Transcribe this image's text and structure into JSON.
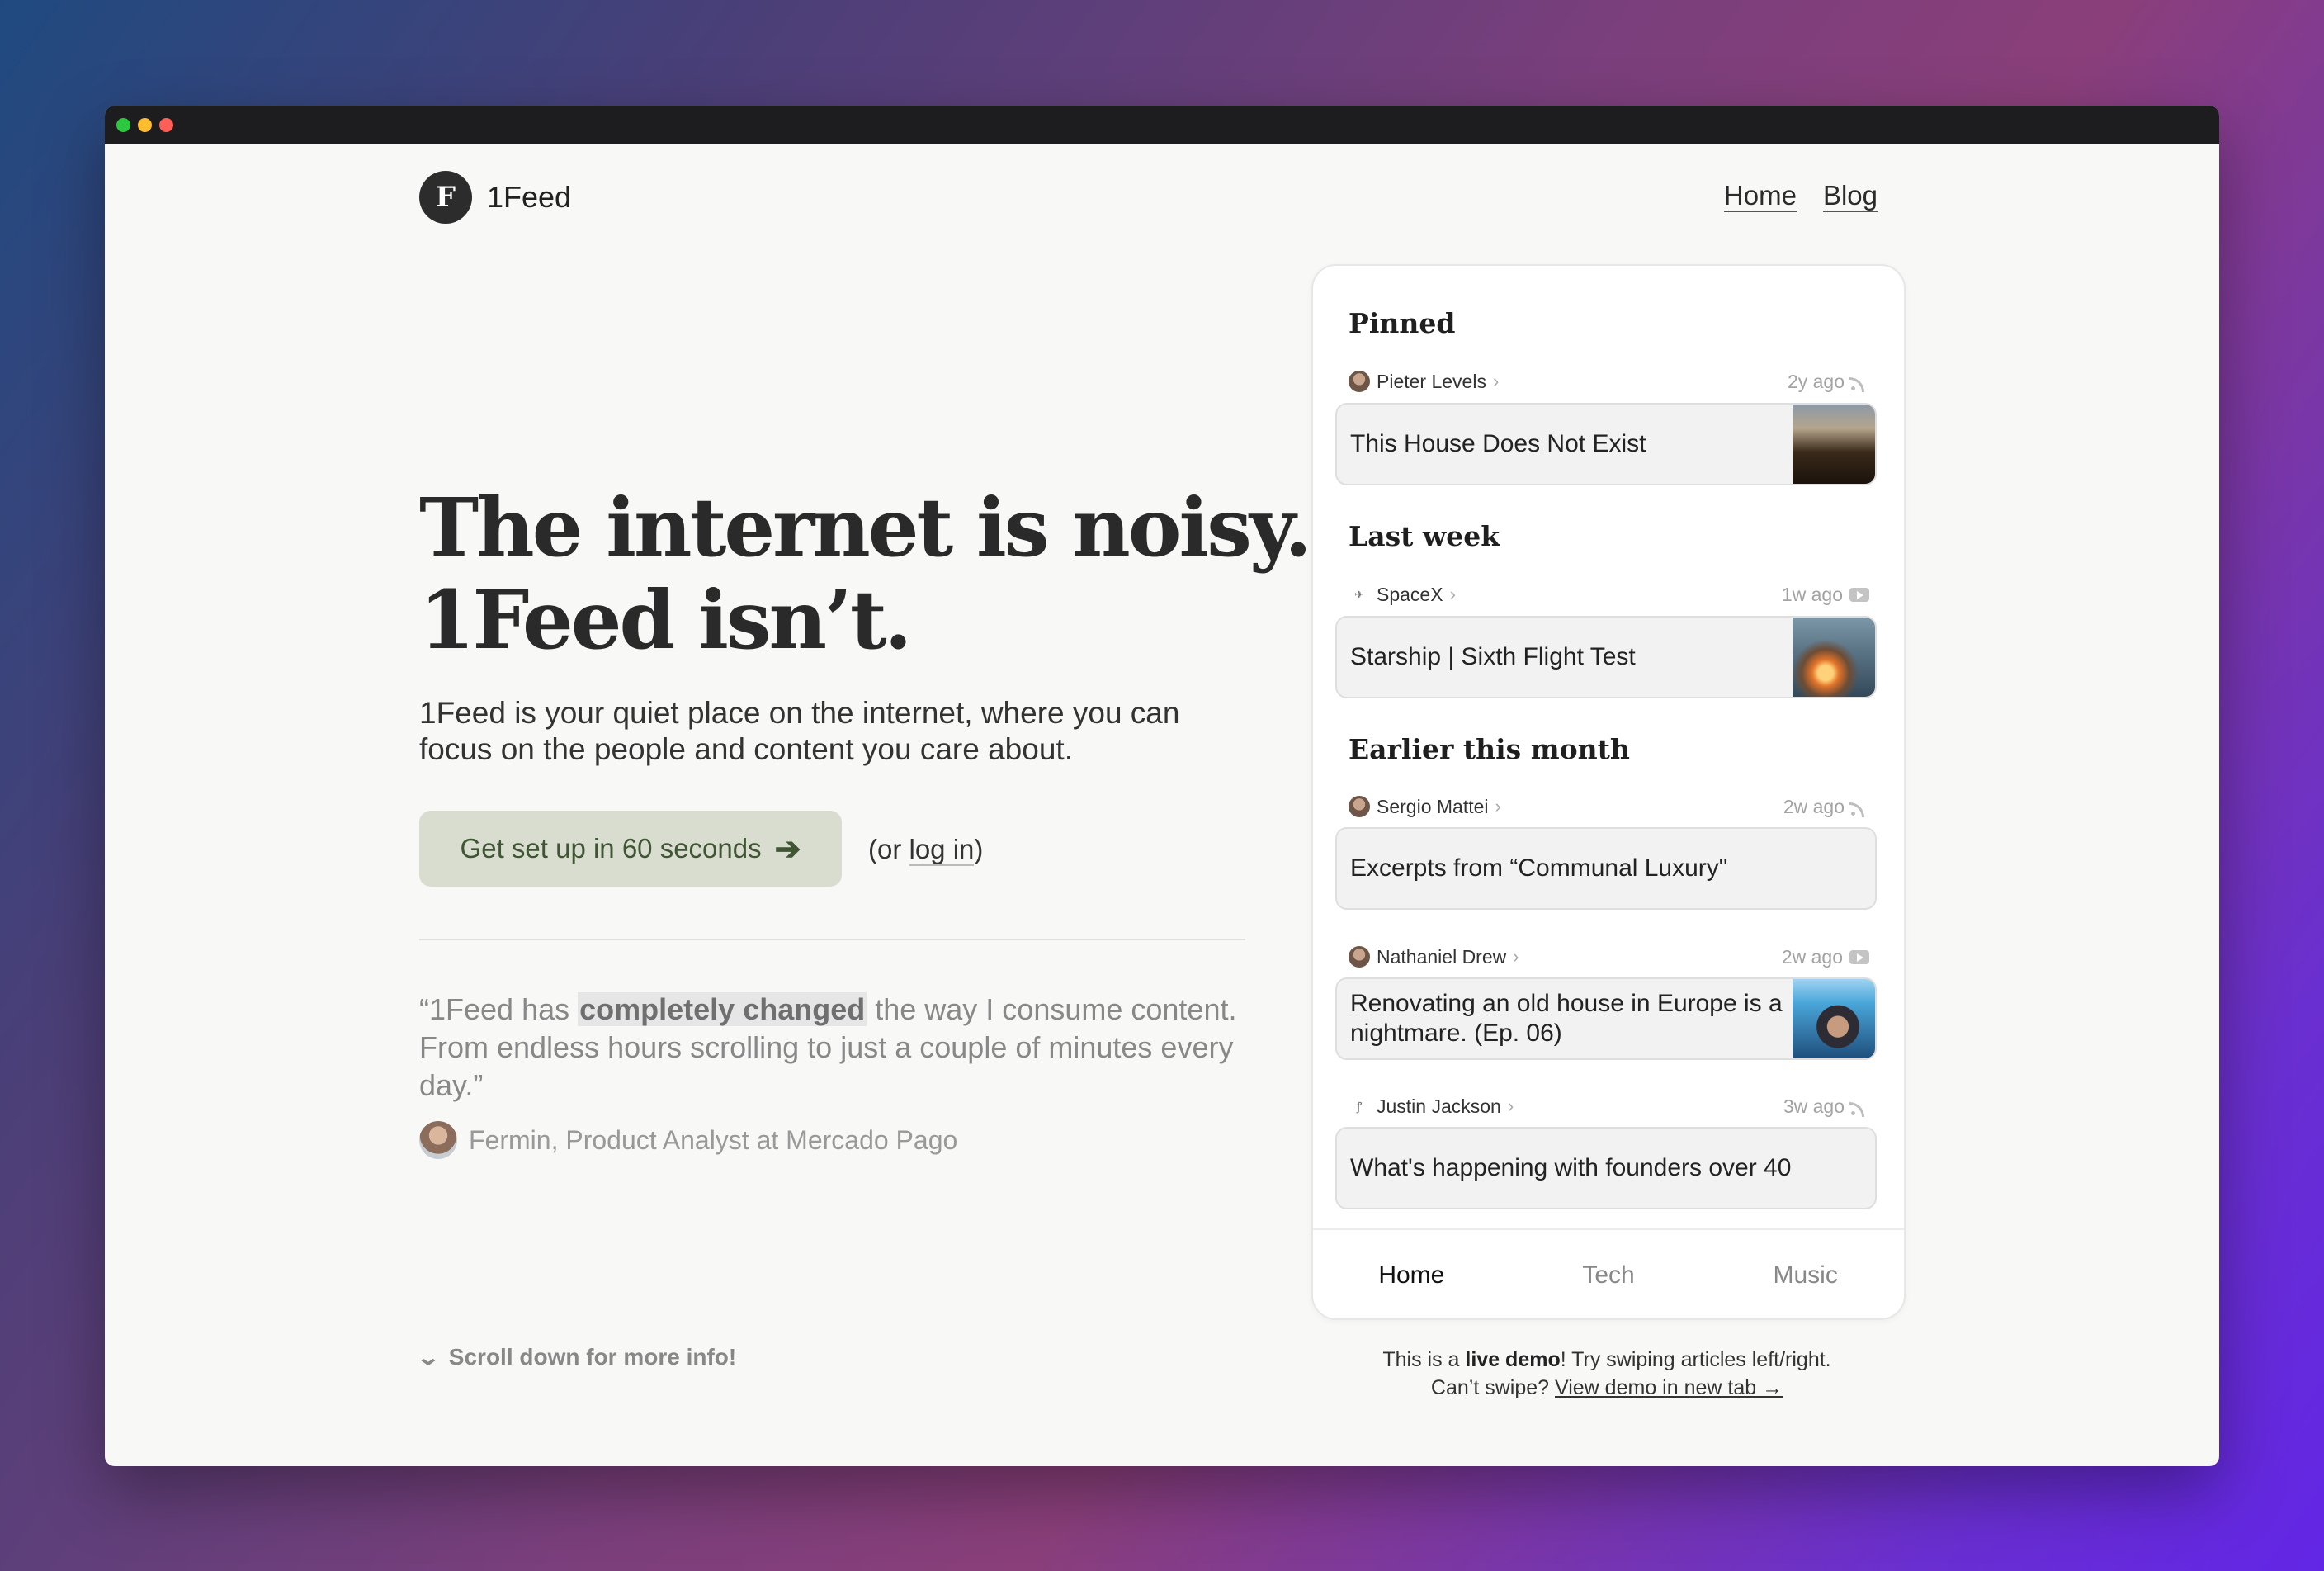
{
  "brand": {
    "name": "1Feed",
    "logo_letter": "F"
  },
  "nav": {
    "home": "Home",
    "blog": "Blog"
  },
  "hero": {
    "headline_line1": "The internet is noisy.",
    "headline_line2": "1Feed isn’t.",
    "subcopy": "1Feed is your quiet place on the internet, where you can focus on the people and content you care about."
  },
  "cta": {
    "label": "Get set up in 60 seconds",
    "arrow": "➔"
  },
  "login": {
    "prefix": "(or ",
    "link": "log in",
    "suffix": ")"
  },
  "testimonial": {
    "before": "“1Feed has ",
    "highlight": "completely changed",
    "after": " the way I consume content. From endless hours scrolling to just a couple of minutes every day.”",
    "author": "Fermin, Product Analyst at Mercado Pago"
  },
  "scroll_hint": "Scroll down for more info!",
  "feed": {
    "sections": [
      {
        "title": "Pinned",
        "items": [
          {
            "author": "Pieter Levels",
            "age": "2y ago",
            "source_icon": "rss-icon",
            "title": "This House Does Not Exist",
            "has_thumb": true
          }
        ]
      },
      {
        "title": "Last week",
        "items": [
          {
            "author": "SpaceX",
            "age": "1w ago",
            "source_icon": "youtube-icon",
            "title": "Starship | Sixth Flight Test",
            "has_thumb": true
          }
        ]
      },
      {
        "title": "Earlier this month",
        "items": [
          {
            "author": "Sergio Mattei",
            "age": "2w ago",
            "source_icon": "rss-icon",
            "title": "Excerpts from “Communal Luxury\"",
            "has_thumb": false
          },
          {
            "author": "Nathaniel Drew",
            "age": "2w ago",
            "source_icon": "youtube-icon",
            "title": "Renovating an old house in Europe is a nightmare. (Ep. 06)",
            "has_thumb": true
          },
          {
            "author": "Justin Jackson",
            "age": "3w ago",
            "source_icon": "rss-icon",
            "title": "What's happening with founders over 40",
            "has_thumb": false
          }
        ]
      }
    ],
    "tabs": [
      "Home",
      "Tech",
      "Music"
    ],
    "active_tab": "Home"
  },
  "demo_note": {
    "prefix": "This is a ",
    "bold": "live demo",
    "rest": "! Try swiping articles left/right.",
    "line2": "Can’t swipe? ",
    "link": "View demo in new tab →"
  },
  "colors": {
    "cta_bg": "#d8ddd0",
    "cta_text": "#3f5533",
    "window_bg": "#f8f8f7",
    "titlebar": "#1d1d1f"
  }
}
